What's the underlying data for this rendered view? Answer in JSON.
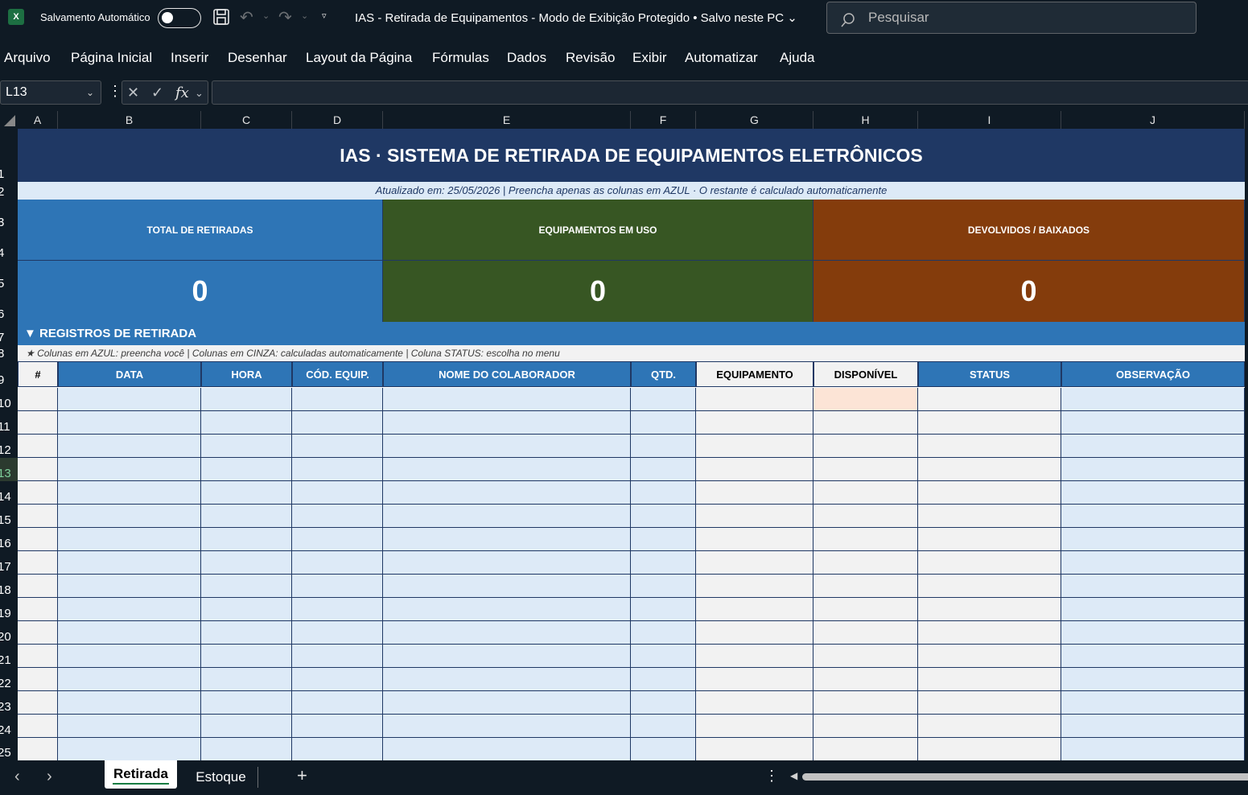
{
  "titlebar": {
    "app_icon": "excel-icon",
    "autosave_label": "Salvamento Automático",
    "autosave_on": false,
    "doc_title": "IAS - Retirada de Equipamentos  -  Modo de Exibição Protegido  •  Salvo neste PC",
    "search_placeholder": "Pesquisar"
  },
  "menu": [
    "Arquivo",
    "Página Inicial",
    "Inserir",
    "Desenhar",
    "Layout da Página",
    "Fórmulas",
    "Dados",
    "Revisão",
    "Exibir",
    "Automatizar",
    "Ajuda"
  ],
  "formula_bar": {
    "name_box": "L13",
    "formula": ""
  },
  "grid": {
    "columns": [
      "A",
      "B",
      "C",
      "D",
      "E",
      "F",
      "G",
      "H",
      "I",
      "J"
    ],
    "rows": [
      "1",
      "2",
      "3",
      "4",
      "5",
      "6",
      "7",
      "8",
      "9",
      "10",
      "11",
      "12",
      "13",
      "14",
      "15",
      "16",
      "17",
      "18",
      "19",
      "20",
      "21",
      "22",
      "23",
      "24",
      "25"
    ],
    "selected_row": "13"
  },
  "sheet": {
    "title": "IAS  ·  SISTEMA DE RETIRADA DE EQUIPAMENTOS ELETRÔNICOS",
    "subtitle": "Atualizado em: 25/05/2026   |   Preencha apenas as colunas em AZUL · O restante é calculado automaticamente",
    "kpis": [
      {
        "label": "TOTAL DE RETIRADAS",
        "value": "0",
        "color": "#2e75b6"
      },
      {
        "label": "EQUIPAMENTOS EM USO",
        "value": "0",
        "color": "#375623"
      },
      {
        "label": "DEVOLVIDOS / BAIXADOS",
        "value": "0",
        "color": "#843c0c"
      }
    ],
    "section_title": "▼  REGISTROS DE RETIRADA",
    "legend": "★  Colunas em AZUL: preencha você  |  Colunas em CINZA: calculadas automaticamente  |  Coluna STATUS: escolha no menu",
    "table_headers": [
      "#",
      "DATA",
      "HORA",
      "CÓD. EQUIP.",
      "NOME DO COLABORADOR",
      "QTD.",
      "EQUIPAMENTO",
      "DISPONÍVEL",
      "STATUS",
      "OBSERVAÇÃO"
    ]
  },
  "tabs": {
    "sheets": [
      "Retirada",
      "Estoque"
    ],
    "active": "Retirada"
  },
  "colors": {
    "header_navy": "#1f3864",
    "input_blue": "#ddeaf7",
    "calc_grey": "#f2f2f2",
    "accent_blue": "#2e75b6",
    "excel_green": "#107c41"
  }
}
